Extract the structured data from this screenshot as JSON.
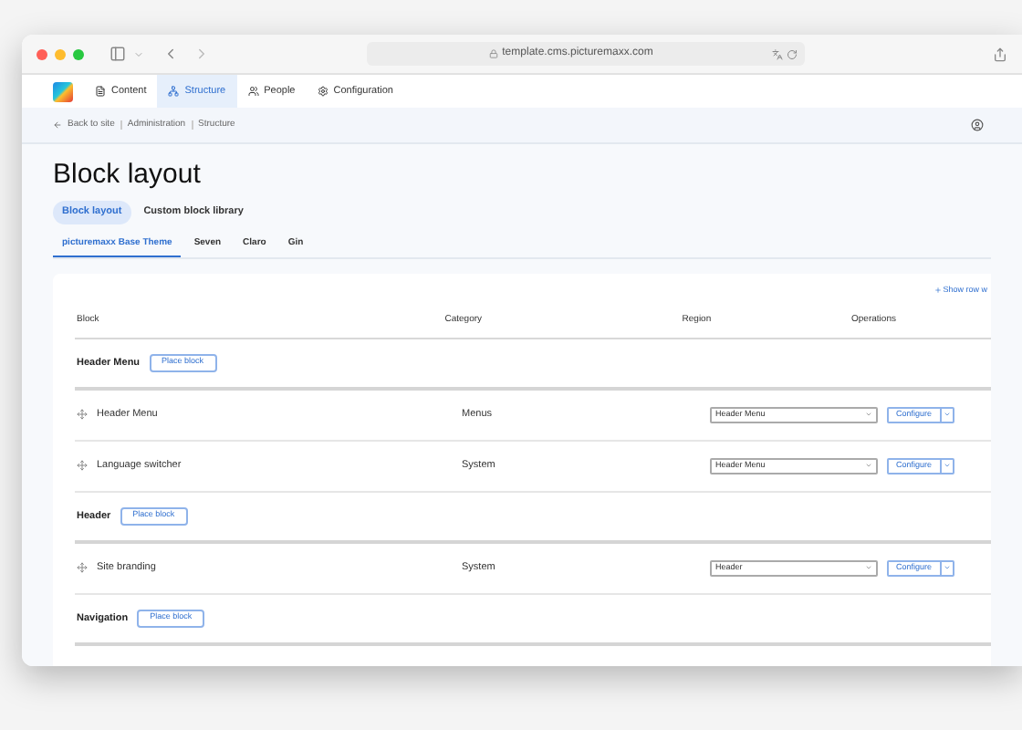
{
  "browser": {
    "url": "template.cms.picturemaxx.com"
  },
  "nav": [
    {
      "label": "Content",
      "selected": false
    },
    {
      "label": "Structure",
      "selected": true
    },
    {
      "label": "People",
      "selected": false
    },
    {
      "label": "Configuration",
      "selected": false
    }
  ],
  "breadcrumb": {
    "back": "Back to site",
    "items": [
      "Administration",
      "Structure"
    ]
  },
  "page_title": "Block layout",
  "primary_tabs": [
    {
      "label": "Block layout",
      "selected": true
    },
    {
      "label": "Custom block library",
      "selected": false
    }
  ],
  "theme_tabs": [
    {
      "label": "picturemaxx Base Theme",
      "selected": true
    },
    {
      "label": "Seven",
      "selected": false
    },
    {
      "label": "Claro",
      "selected": false
    },
    {
      "label": "Gin",
      "selected": false
    }
  ],
  "show_row_weights": "Show row w",
  "table": {
    "columns": [
      "Block",
      "Category",
      "Region",
      "Operations"
    ],
    "sections": [
      {
        "region": "Header Menu",
        "place_button": "Place block",
        "blocks": [
          {
            "name": "Header Menu",
            "category": "Menus",
            "region": "Header Menu",
            "operation": "Configure"
          },
          {
            "name": "Language switcher",
            "category": "System",
            "region": "Header Menu",
            "operation": "Configure"
          }
        ]
      },
      {
        "region": "Header",
        "place_button": "Place block",
        "blocks": [
          {
            "name": "Site branding",
            "category": "System",
            "region": "Header",
            "operation": "Configure"
          }
        ]
      },
      {
        "region": "Navigation",
        "place_button": "Place block"
      }
    ]
  }
}
